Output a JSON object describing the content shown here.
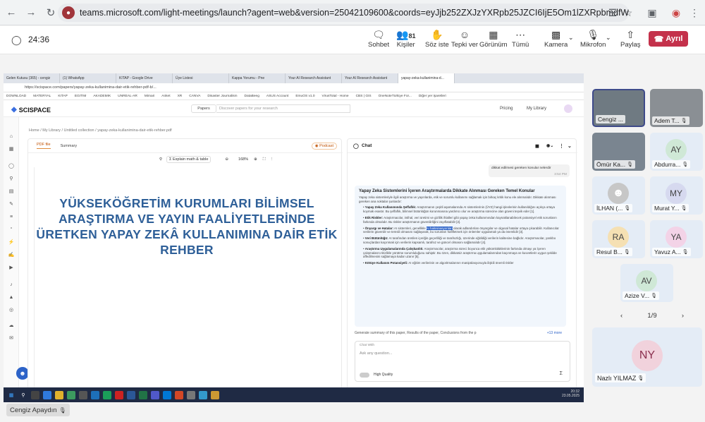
{
  "browser": {
    "url": "teams.microsoft.com/light-meetings/launch?agent=web&version=25042109600&coords=eyJjb252ZXJzYXRpb25JZCI6IjE5Om1lZXRpbmdfWkRVeU1qUTNPRFF..."
  },
  "teams": {
    "timer": "24:36",
    "controls": [
      {
        "label": "Sohbet",
        "icon": "chat-icon"
      },
      {
        "label": "Kişiler",
        "icon": "people-icon",
        "count": "81"
      },
      {
        "label": "Söz iste",
        "icon": "hand-icon"
      },
      {
        "label": "Tepki ver",
        "icon": "smile-icon"
      },
      {
        "label": "Görünüm",
        "icon": "grid-icon"
      },
      {
        "label": "Tümü",
        "icon": "more-icon"
      },
      {
        "label": "Kamera",
        "icon": "camera-off-icon"
      },
      {
        "label": "Mikrofon",
        "icon": "mic-off-icon"
      },
      {
        "label": "Paylaş",
        "icon": "share-icon"
      }
    ],
    "leave_label": "Ayrıl"
  },
  "shared": {
    "tabs": [
      "Gelen Kutusu (365) - cengiz",
      "(1) WhatsApp",
      "KITAP - Google Drive",
      "Üye Listesi",
      "Kappa Yorumu - Pne",
      "Your AI Research Assistant",
      "Your AI Research Assistant",
      "yapay-zeka-kullanimina-d..."
    ],
    "address": "https://scispace.com/papers/yapay-zeka-kullanimina-dair-etik-rehber-pdf-b/...",
    "bookmarks": [
      "DOWNLOAD",
      "MATERYAL",
      "KITAP",
      "EGITIM",
      "AKADEMIK",
      "UNREAL-AR",
      "Mimari",
      "Anket",
      "XR",
      "CANVA",
      "Disaster Journalism",
      "DataBeeg",
      "ASUS Account",
      "EmuOS v1.0",
      "VirusTotal - Home",
      "CBS | GIS",
      "OneNoteTürkiye For...",
      "Diğer yer işaretleri"
    ],
    "brand": "SCISPACE",
    "papers_dropdown": "Papers",
    "search_placeholder": "Discover papers for your research",
    "pricing": "Pricing",
    "my_library": "My Library",
    "breadcrumb": "Home  /  My Library  /  Untitled collection  /  yapay-zeka-kullanimina-dair-etik-rehber.pdf",
    "pdf_tabs": [
      "PDF file",
      "Summary"
    ],
    "podcast": "Podcast",
    "explain": "Explain math & table",
    "zoom": "168%",
    "pdf_title": "YÜKSEKÖĞRETİM KURUMLARI BİLİMSEL ARAŞTIRMA VE YAYIN FAALİYETLERİNDE ÜRETKEN YAPAY ZEKÂ KULLANIMINA DAİR ETİK REHBER",
    "chat_title": "Chat",
    "user_msg": "dikkat edilmesi gereken konular nelerdir",
    "user_time": "3:54 PM",
    "answer_heading": "Yapay Zeka Sistemlerini İçeren Araştırmalarda Dikkate Alınması Gereken Temel Konular",
    "answer_intro": "Yapay zeka sistemleriyle ilgili araştırma ve yayınlarda, etik ve sorumlu kullanımı sağlamak için birkaç kritik konu ele alınmalıdır. Dikkate alınması gereken ana noktalar şunlardır:",
    "answer_items": [
      {
        "title": "Yapay Zeka Kullanımında Şeffaflık:",
        "text": "Araştırmanın çeşitli aşamalarında AI sistemlerinin (ÜYZ) hangi işlevlerinin kullanıldığını açıkça ortaya koymak esastır. Bu şeffaflık, bilimsel bütünlüğün korunmasına yardımcı olur ve araştırma sürecine olan güveni teşvik eder [1]."
      },
      {
        "title": "Etik Riskler:",
        "text": "Araştırmacılar, intihal, veri üretimi ve gizlilik ihlalleri gibi yapay zeka kullanımından kaynaklanabilecek potansiyel etik sorunların farkında olmalıdır. Bu riskler araştırmanın güvenilirliğini zayıflatabilir [2]."
      },
      {
        "title": "Önyargı ve Hatalar:",
        "text": "AI sistemleri, genellikle",
        "highlight": "AI halüsinasyonları",
        "text2": "olarak adlandırılan önyargılar ve olgusal hatalar ortaya çıkarabilir. Kullanıcılar verilerin güvenilir ve temsili olmasını sağlayarak, bu sorunları hafifletmek için önlemler uygulamalı ya da önemlidir [3]."
      },
      {
        "title": "Veri Bütünlüğü:",
        "text": "AI tarafından üretilen içeriğin geçerliliği ve tarafsızlığı, üzerinde eğitildiği verilerin kalitesine bağlıdır. Araştırmacılar, yanlıbo sonuçlardan kaçınmak için verilerin kapsamlı, tarafsız ve güncel olmasını sağlamalıdır [4]."
      },
      {
        "title": "Araştırma Uygulamalarında Çalışkanlık:",
        "text": "Araştırmacılar, araştırma süreci boyunca etik yükümlülüklerinin farkında olmayı ya İçeren çalışmalarını titizlikle yürütme sorumluluğunu sahiptir. Bu özen, dikkatsiz araştırma uygulamalarından kaçınmaya ve kuvvetlerin uygun şekilde affedilmesini sağlamaya kadar uzanır [5]."
      },
      {
        "title": "Kötüye Kullanım Potansiyeli:",
        "text": "AI eğitim verilerinin ve algoritmalarının manipülasyonuyla ilişkili önemli riskler"
      }
    ],
    "gen_summary": "Generate summary of this paper, Results of the paper, Conclusions from the p",
    "more": "+13 more",
    "chat_with": "Chat With",
    "ask_placeholder": "Ask any question...",
    "high_quality": "High Quality",
    "clock_time": "20:32",
    "clock_date": "23.05.2025"
  },
  "presenter": "Cengiz Apaydın",
  "participants": [
    {
      "name": "Cengiz ...",
      "initials": "",
      "video": true,
      "color": "#6f7a82"
    },
    {
      "name": "Adem T...",
      "initials": "",
      "video": true,
      "color": "#8a8f94"
    },
    {
      "name": "Ömür Ka...",
      "initials": "",
      "video": true,
      "color": "#7a8590"
    },
    {
      "name": "Abdurra...",
      "initials": "AY",
      "video": false,
      "color": "#cfe8d6"
    },
    {
      "name": "İLHAN (...",
      "initials": "",
      "video": false,
      "color": "#c7c7c7"
    },
    {
      "name": "Murat Y...",
      "initials": "MY",
      "video": false,
      "color": "#d6d9ef"
    },
    {
      "name": "Resul B...",
      "initials": "RA",
      "video": false,
      "color": "#f5e0b3"
    },
    {
      "name": "Yavuz A...",
      "initials": "YA",
      "video": false,
      "color": "#f3d3e7"
    },
    {
      "name": "Azize V...",
      "initials": "AV",
      "video": false,
      "color": "#cfe8d6"
    }
  ],
  "pager": "1/9",
  "big_participant": {
    "name": "Nazlı YILMAZ",
    "initials": "NY",
    "color": "#f1d2dc"
  }
}
